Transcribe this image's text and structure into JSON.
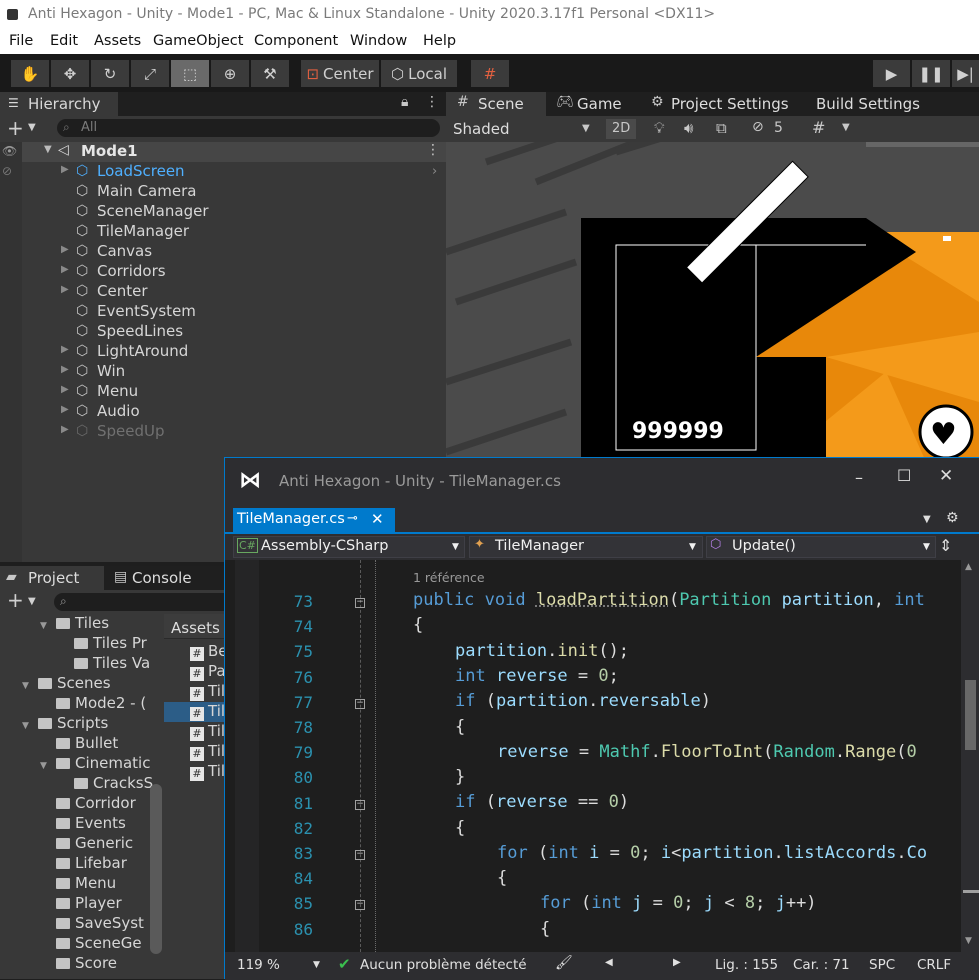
{
  "unity": {
    "title": "Anti Hexagon - Unity - Mode1 - PC, Mac & Linux Standalone - Unity 2020.3.17f1 Personal <DX11>",
    "menu": [
      "File",
      "Edit",
      "Assets",
      "GameObject",
      "Component",
      "Window",
      "Help"
    ],
    "toolbar": {
      "tools": [
        "hand-tool",
        "move-tool",
        "rotate-tool",
        "scale-tool",
        "rect-tool",
        "transform-tool",
        "custom-tool"
      ],
      "selected_tool_index": 4,
      "pivot_label": "Center",
      "space_label": "Local",
      "play_icons": [
        "play",
        "pause",
        "step"
      ]
    }
  },
  "hierarchy": {
    "tab": "Hierarchy",
    "search_placeholder": "All",
    "scene": "Mode1",
    "items": [
      {
        "label": "LoadScreen",
        "arrow": true,
        "selected": true
      },
      {
        "label": "Main Camera",
        "arrow": false
      },
      {
        "label": "SceneManager",
        "arrow": false
      },
      {
        "label": "TileManager",
        "arrow": false
      },
      {
        "label": "Canvas",
        "arrow": true
      },
      {
        "label": "Corridors",
        "arrow": true
      },
      {
        "label": "Center",
        "arrow": true
      },
      {
        "label": "EventSystem",
        "arrow": false
      },
      {
        "label": "SpeedLines",
        "arrow": false
      },
      {
        "label": "LightAround",
        "arrow": true
      },
      {
        "label": "Win",
        "arrow": true
      },
      {
        "label": "Menu",
        "arrow": true
      },
      {
        "label": "Audio",
        "arrow": true
      },
      {
        "label": "SpeedUp",
        "arrow": true,
        "disabled": true
      }
    ]
  },
  "scene": {
    "tabs": [
      "Scene",
      "Game",
      "Project Settings",
      "Build Settings"
    ],
    "active_tab": "Scene",
    "shading": "Shaded",
    "mode_2d": "2D",
    "hidden_count": "5",
    "score_text": "999999"
  },
  "project": {
    "tabs": [
      "Project",
      "Console"
    ],
    "tree": [
      {
        "label": "Tiles",
        "indent": 2,
        "expanded": true
      },
      {
        "label": "Tiles Pr",
        "indent": 3
      },
      {
        "label": "Tiles Va",
        "indent": 3
      },
      {
        "label": "Scenes",
        "indent": 1,
        "expanded": true
      },
      {
        "label": "Mode2 - (",
        "indent": 2
      },
      {
        "label": "Scripts",
        "indent": 1,
        "expanded": true
      },
      {
        "label": "Bullet",
        "indent": 2
      },
      {
        "label": "Cinematic",
        "indent": 2,
        "expanded": true
      },
      {
        "label": "CracksS",
        "indent": 3
      },
      {
        "label": "Corridor",
        "indent": 2
      },
      {
        "label": "Events",
        "indent": 2
      },
      {
        "label": "Generic",
        "indent": 2
      },
      {
        "label": "Lifebar",
        "indent": 2
      },
      {
        "label": "Menu",
        "indent": 2
      },
      {
        "label": "Player",
        "indent": 2
      },
      {
        "label": "SaveSyst",
        "indent": 2
      },
      {
        "label": "SceneGe",
        "indent": 2
      },
      {
        "label": "Score",
        "indent": 2
      }
    ],
    "assets_header": "Assets",
    "asset_files": [
      "Be",
      "Pa",
      "Til",
      "Til",
      "Til",
      "Til",
      "Til"
    ],
    "selected_asset_index": 3
  },
  "vs": {
    "title": "Anti Hexagon - Unity - TileManager.cs",
    "tab": "TileManager.cs",
    "nav": {
      "project": "Assembly-CSharp",
      "class": "TileManager",
      "member": "Update()"
    },
    "codelens": "1 référence",
    "lines": [
      73,
      74,
      75,
      76,
      77,
      78,
      79,
      80,
      81,
      82,
      83,
      84,
      85,
      86
    ],
    "folds": [
      73,
      77,
      81,
      83,
      85
    ],
    "status": {
      "zoom": "119 %",
      "issues": "Aucun problème détecté",
      "line": "Lig. : 155",
      "col": "Car. : 71",
      "spacing": "SPC",
      "eol": "CRLF"
    },
    "colors": {
      "accent": "#007acc",
      "keyword": "#569cd6",
      "type": "#4ec9b0",
      "method": "#dcdcaa",
      "number": "#b5cea8",
      "identifier": "#9cdcfe"
    }
  }
}
